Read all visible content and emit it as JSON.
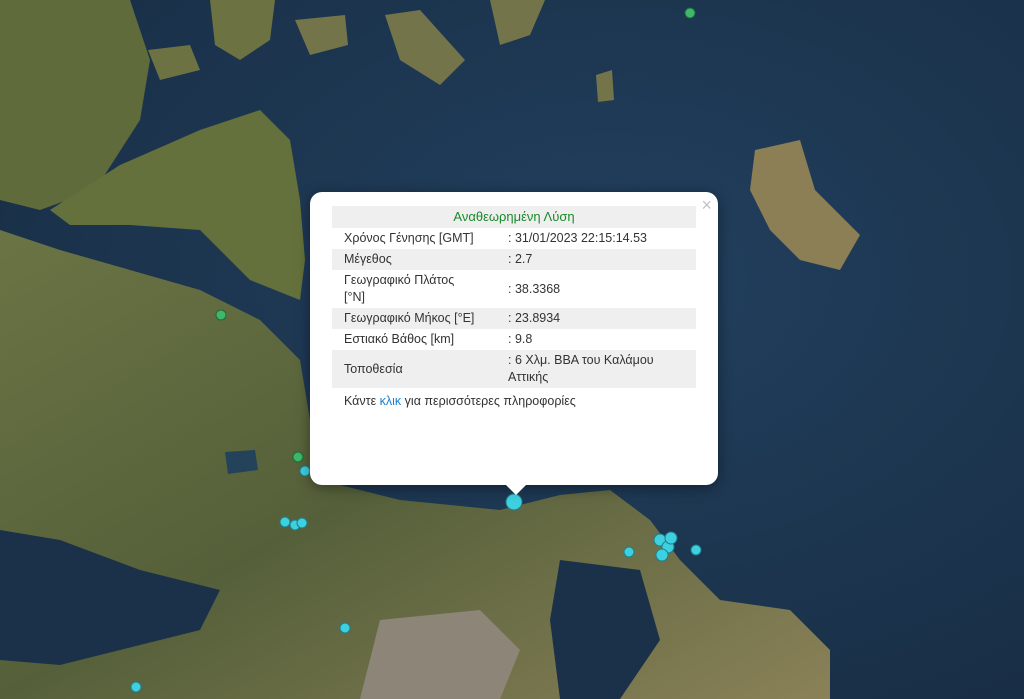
{
  "popup": {
    "title": "Αναθεωρημένη Λύση",
    "close_label": "×",
    "rows": [
      {
        "label": "Χρόνος Γένησης [GMT]",
        "value": ": 31/01/2023 22:15:14.53"
      },
      {
        "label": "Μέγεθος",
        "value": ": 2.7"
      },
      {
        "label": "Γεωγραφικό Πλάτος [°N]",
        "value": ": 38.3368"
      },
      {
        "label": "Γεωγραφικό Μήκος [°E]",
        "value": ": 23.8934"
      },
      {
        "label": "Εστιακό Βάθος [km]",
        "value": ": 9.8"
      },
      {
        "label": "Τοποθεσία",
        "value": ": 6 Χλμ. ΒΒΑ του Καλάμου Αττικής"
      }
    ],
    "more_prefix": "Κάντε ",
    "more_link": "κλικ",
    "more_suffix": " για περισσότερες πληροφορίες"
  },
  "colors": {
    "sea": "#1d3550",
    "land": "#5d6a3a",
    "marker_green": "#3fb86a",
    "marker_cyan": "#3fd0e0",
    "popup_title": "#1a8a2a",
    "link": "#1a7fd0"
  }
}
